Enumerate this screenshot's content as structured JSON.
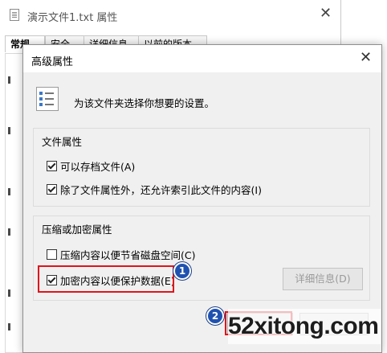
{
  "bg_window": {
    "title": "演示文件1.txt 属性",
    "tabs": [
      "常规",
      "安全",
      "详细信息",
      "以前的版本"
    ]
  },
  "dialog": {
    "title": "高级属性",
    "description": "为该文件夹选择你想要的设置。",
    "file_attributes": {
      "title": "文件属性",
      "archive_label": "可以存档文件(A)",
      "archive_checked": true,
      "index_label": "除了文件属性外，还允许索引此文件的内容(I)",
      "index_checked": true
    },
    "compress_encrypt": {
      "title": "压缩或加密属性",
      "compress_label": "压缩内容以便节省磁盘空间(C)",
      "compress_checked": false,
      "encrypt_label": "加密内容以便保护数据(E)",
      "encrypt_checked": true,
      "details_button": "详细信息(D)",
      "details_enabled": false
    }
  },
  "annotations": {
    "badge_1": "1",
    "badge_2": "2",
    "highlight_color": "#e0141a",
    "badge_color": "#1f52b0"
  },
  "watermark": "52xitong.com"
}
